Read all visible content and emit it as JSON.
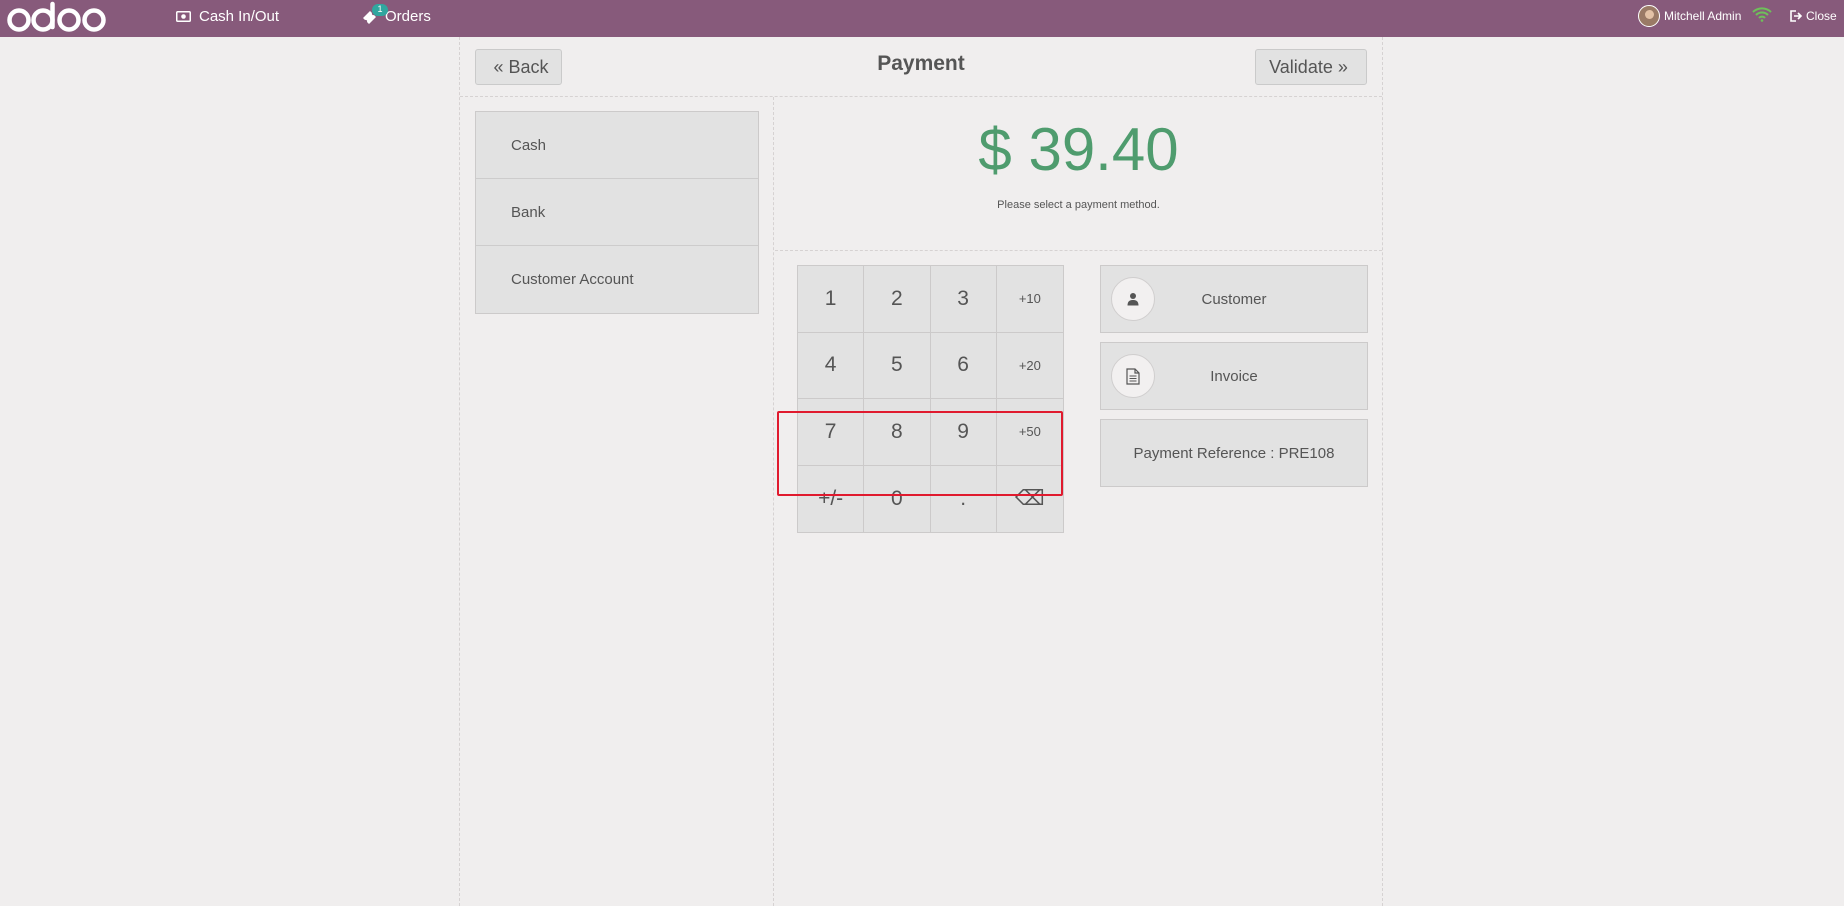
{
  "topbar": {
    "logo_text": "odoo",
    "cash_in_out_label": "Cash In/Out",
    "orders_label": "Orders",
    "orders_badge": "1",
    "user_name": "Mitchell Admin",
    "close_label": "Close"
  },
  "header": {
    "back_label": "Back",
    "title": "Payment",
    "validate_label": "Validate"
  },
  "payment_methods": [
    {
      "label": "Cash"
    },
    {
      "label": "Bank"
    },
    {
      "label": "Customer Account"
    }
  ],
  "summary": {
    "total": "$ 39.40",
    "hint": "Please select a payment method."
  },
  "numpad": {
    "keys": [
      "1",
      "2",
      "3",
      "+10",
      "4",
      "5",
      "6",
      "+20",
      "7",
      "8",
      "9",
      "+50",
      "+/-",
      "0",
      ".",
      "⌫"
    ]
  },
  "actions": {
    "customer_label": "Customer",
    "invoice_label": "Invoice",
    "payment_reference_label": "Payment Reference : PRE108"
  },
  "colors": {
    "topbar": "#875a7b",
    "total_green": "#4f9c6e",
    "badge": "#30a69f",
    "highlight": "#e01a2e"
  }
}
